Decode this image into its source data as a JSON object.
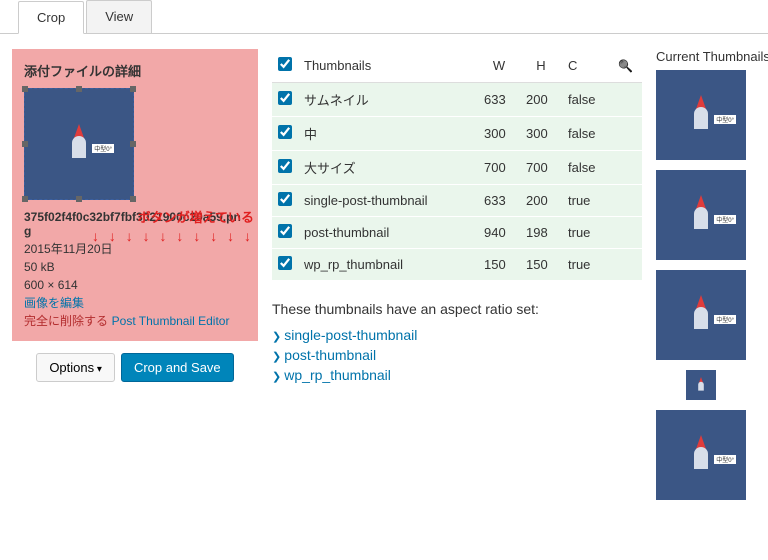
{
  "tabs": {
    "crop": "Crop",
    "view": "View"
  },
  "attach": {
    "title": "添付ファイルの詳細",
    "filename": "375f02f4f0c32bf7fbf3021900c20a59.png",
    "date": "2015年11月20日",
    "size": "50 kB",
    "dims": "600 × 614",
    "edit": "画像を編集",
    "delete": "完全に削除する",
    "pte": "Post Thumbnail Editor",
    "rocket_tag": "中型0°"
  },
  "annotation": {
    "text": "ボタンが増えている"
  },
  "buttons": {
    "options": "Options",
    "crop_save": "Crop and Save"
  },
  "table": {
    "headers": {
      "name": "Thumbnails",
      "w": "W",
      "h": "H",
      "c": "C"
    },
    "rows": [
      {
        "name": "サムネイル",
        "w": "633",
        "h": "200",
        "c": "false"
      },
      {
        "name": "中",
        "w": "300",
        "h": "300",
        "c": "false"
      },
      {
        "name": "大サイズ",
        "w": "700",
        "h": "700",
        "c": "false"
      },
      {
        "name": "single-post-thumbnail",
        "w": "633",
        "h": "200",
        "c": "true"
      },
      {
        "name": "post-thumbnail",
        "w": "940",
        "h": "198",
        "c": "true"
      },
      {
        "name": "wp_rp_thumbnail",
        "w": "150",
        "h": "150",
        "c": "true"
      }
    ]
  },
  "aspect": {
    "text": "These thumbnails have an aspect ratio set:",
    "items": [
      "single-post-thumbnail",
      "post-thumbnail",
      "wp_rp_thumbnail"
    ]
  },
  "right": {
    "title": "Current Thumbnails"
  }
}
